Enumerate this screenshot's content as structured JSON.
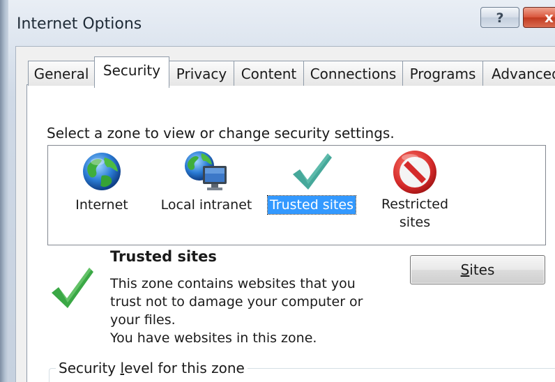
{
  "window": {
    "title": "Internet Options",
    "help_label": "?",
    "close_label": "x"
  },
  "tabs": [
    {
      "label": "General",
      "active": false
    },
    {
      "label": "Security",
      "active": true
    },
    {
      "label": "Privacy",
      "active": false
    },
    {
      "label": "Content",
      "active": false
    },
    {
      "label": "Connections",
      "active": false
    },
    {
      "label": "Programs",
      "active": false
    },
    {
      "label": "Advanced",
      "active": false
    }
  ],
  "security": {
    "prompt": "Select a zone to view or change security settings.",
    "zones": [
      {
        "label": "Internet",
        "icon": "globe-icon",
        "selected": false
      },
      {
        "label": "Local intranet",
        "icon": "globe-monitor-icon",
        "selected": false
      },
      {
        "label": "Trusted sites",
        "icon": "green-check-icon",
        "selected": true
      },
      {
        "label": "Restricted\nsites",
        "icon": "no-entry-icon",
        "selected": false
      }
    ],
    "selected_zone": {
      "title": "Trusted sites",
      "description_lines": [
        "This zone contains websites that you",
        "trust not to damage your computer or",
        "your files.",
        "You have websites in this zone."
      ],
      "icon": "green-check-icon"
    },
    "sites_button": {
      "mnemonic": "S",
      "rest": "ites"
    },
    "level_group": {
      "prefix": "Security ",
      "mnemonic": "l",
      "rest": "evel for this zone"
    }
  },
  "colors": {
    "selection": "#3399ff",
    "check_green": "#3aa845",
    "check_teal": "#46a89a",
    "restricted_red": "#d42a2a"
  }
}
